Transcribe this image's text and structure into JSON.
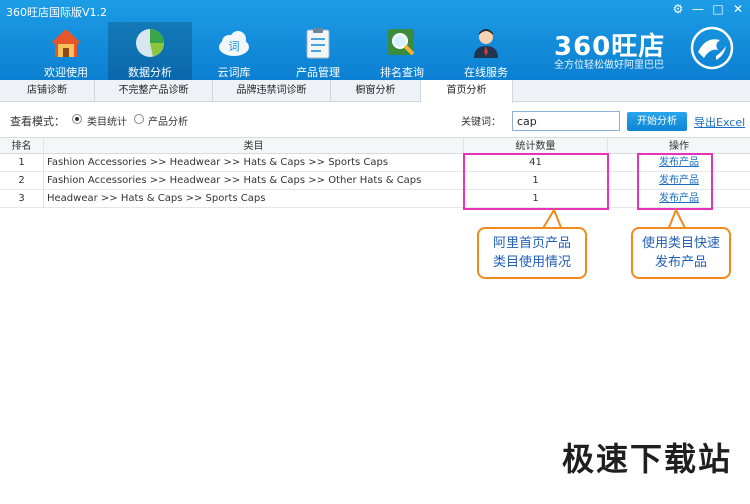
{
  "window": {
    "title": "360旺店国际版V1.2",
    "controls": [
      "⚙",
      "—",
      "□",
      "✕"
    ]
  },
  "nav": {
    "items": [
      {
        "label": "欢迎使用",
        "icon": "home-icon"
      },
      {
        "label": "数据分析",
        "icon": "pie-chart-icon",
        "active": true
      },
      {
        "label": "云词库",
        "icon": "cloud-icon"
      },
      {
        "label": "产品管理",
        "icon": "clipboard-icon"
      },
      {
        "label": "排名查询",
        "icon": "magnifier-icon"
      },
      {
        "label": "在线服务",
        "icon": "agent-icon"
      }
    ]
  },
  "brand": {
    "name": "360旺店",
    "slogan": "全方位轻松做好阿里巴巴"
  },
  "tabs": [
    {
      "label": "店铺诊断"
    },
    {
      "label": "不完整产品诊断"
    },
    {
      "label": "品牌违禁词诊断"
    },
    {
      "label": "橱窗分析"
    },
    {
      "label": "首页分析",
      "active": true
    }
  ],
  "filter": {
    "mode_label": "查看模式：",
    "option_category": "类目统计",
    "option_product": "产品分析",
    "keyword_label": "关键词：",
    "keyword_value": "cap",
    "start_button": "开始分析",
    "export_link": "导出Excel"
  },
  "table": {
    "headers": {
      "rank": "排名",
      "category": "类目",
      "count": "统计数量",
      "operation": "操作"
    },
    "rows": [
      {
        "rank": "1",
        "category": "Fashion Accessories >> Headwear >> Hats & Caps >> Sports Caps",
        "count": "41",
        "operation": "发布产品"
      },
      {
        "rank": "2",
        "category": "Fashion Accessories >> Headwear >> Hats & Caps >> Other Hats & Caps",
        "count": "1",
        "operation": "发布产品"
      },
      {
        "rank": "3",
        "category": "Headwear >> Hats & Caps >> Sports Caps",
        "count": "1",
        "operation": "发布产品"
      }
    ]
  },
  "annotations": {
    "callout_left": {
      "line1": "阿里首页产品",
      "line2": "类目使用情况"
    },
    "callout_right": {
      "line1": "使用类目快速",
      "line2": "发布产品"
    }
  },
  "watermark": "极速下载站",
  "colors": {
    "header": "#0c7fd1",
    "highlight": "#e633b8",
    "callout_border": "#f08a1e",
    "link": "#1a6fc2"
  }
}
